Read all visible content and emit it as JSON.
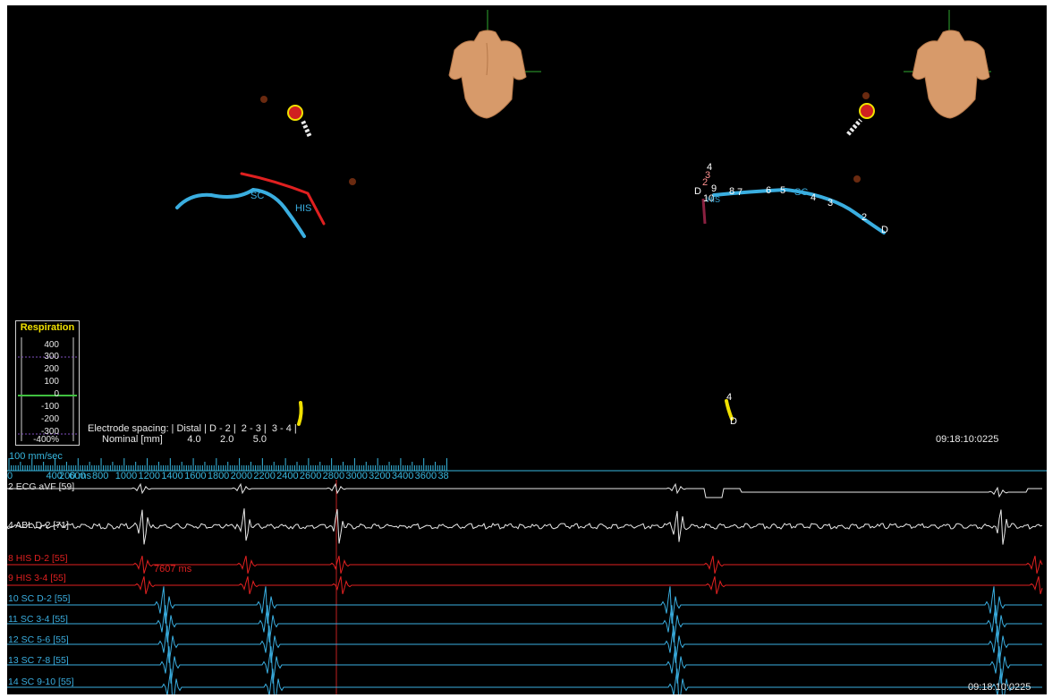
{
  "respiration": {
    "title": "Respiration",
    "ticks": [
      "400",
      "300",
      "200",
      "100",
      "0",
      "-100",
      "-200",
      "-300",
      "-400%"
    ]
  },
  "electrode_spacing": {
    "line1": "Electrode spacing: | Distal | D - 2 |  2 - 3 |  3 - 4 |",
    "line2": "Nominal [mm]         4.0       2.0       5.0"
  },
  "timestamp_top": "09:18:10:0225",
  "timestamp_bottom": "09:18:10:0225",
  "paper_speed": "100 mm/sec",
  "ruler": {
    "start_label": "0",
    "first_label": "200 ms",
    "labels": [
      "400",
      "600",
      "800",
      "1000",
      "1200",
      "1400",
      "1600",
      "1800",
      "2000",
      "2200",
      "2400",
      "2600",
      "2800",
      "3000",
      "3200",
      "3400",
      "3600",
      "38"
    ]
  },
  "interval_measure": "7607 ms",
  "catheter_labels_left": {
    "sc": "SC",
    "his": "HIS"
  },
  "catheter_labels_right": {
    "d": "D",
    "n10": "10",
    "n9": "9",
    "n8": "8",
    "n7": "7",
    "n6": "6",
    "n5": "5",
    "sc": "SC",
    "n4": "4",
    "n3": "3",
    "n2": "2",
    "d_end": "D",
    "his": "HIS",
    "stack4": "4",
    "stack3": "3",
    "stack2": "2"
  },
  "esophageal_labels": {
    "top": "4",
    "bottom": "D"
  },
  "channels": [
    {
      "label": "2  ECG aVF [59]",
      "color": "#e8e8e8"
    },
    {
      "label": "4  ABL D-2 [71]",
      "color": "#e8e8e8"
    },
    {
      "label": "8  HIS D-2 [55]",
      "color": "#e02020"
    },
    {
      "label": "9  HIS 3-4 [55]",
      "color": "#e02020"
    },
    {
      "label": "10  SC D-2 [55]",
      "color": "#3aaee0"
    },
    {
      "label": "11  SC 3-4 [55]",
      "color": "#3aaee0"
    },
    {
      "label": "12  SC 5-6 [55]",
      "color": "#3aaee0"
    },
    {
      "label": "13  SC 7-8 [55]",
      "color": "#3aaee0"
    },
    {
      "label": "14  SC 9-10 [55]",
      "color": "#3aaee0"
    }
  ],
  "colors": {
    "background": "#000000",
    "ecg_white": "#e8e8e8",
    "his_red": "#e02020",
    "cs_blue": "#3aaee0",
    "ruler_cyan": "#38b8e0",
    "torso": "#d79a6a",
    "axis_green": "#2fa82f",
    "respiration_yellow": "#f0e000"
  }
}
